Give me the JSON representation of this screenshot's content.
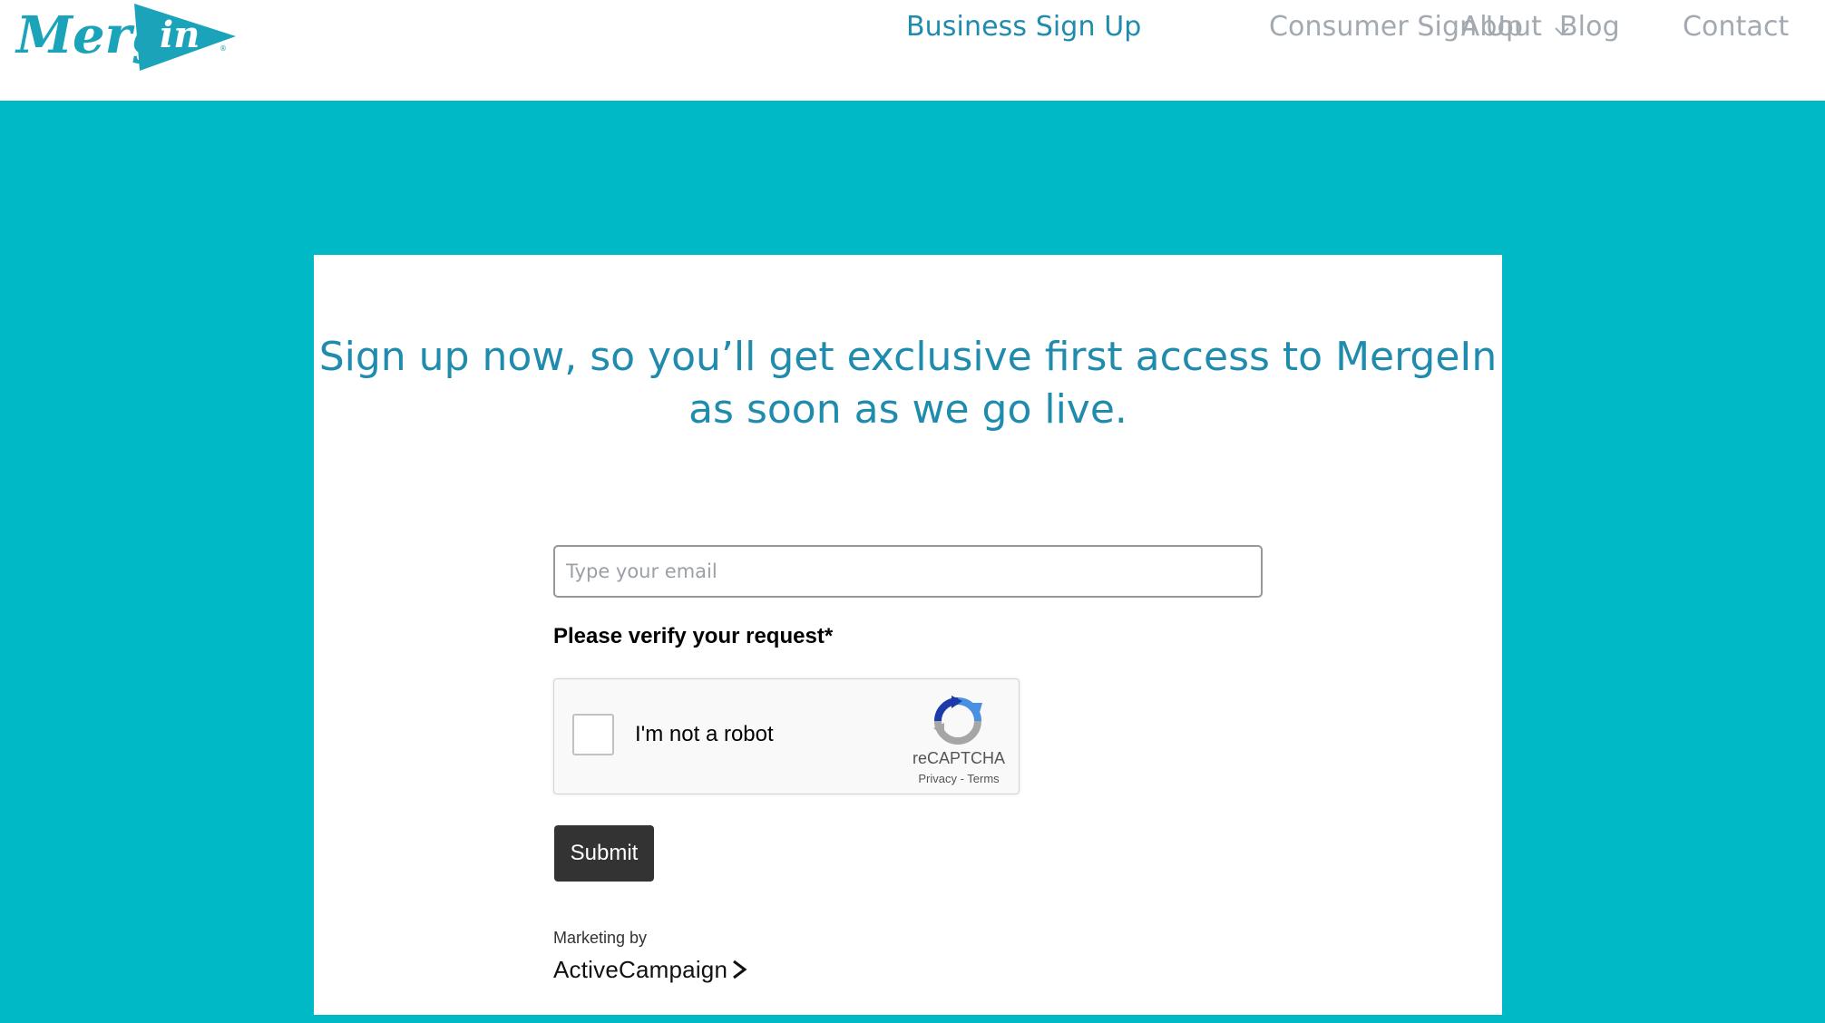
{
  "brand": {
    "logo_text": "Mergein",
    "colors": {
      "accent": "#1f8bad",
      "background": "#00b9c6",
      "nav_text": "#a2a9b1",
      "button": "#333333"
    }
  },
  "nav": {
    "items": [
      {
        "label": "About",
        "has_dropdown": true
      },
      {
        "label": "Business Sign Up",
        "active": true
      },
      {
        "label": "Consumer Sign Up"
      },
      {
        "label": "Blog"
      },
      {
        "label": "Contact"
      }
    ]
  },
  "main": {
    "headline_line1": "Sign up now, so you’ll get exclusive first access to MergeIn",
    "headline_line2": "as soon as we go live.",
    "email_placeholder": "Type your email",
    "email_value": "",
    "verify_label": "Please verify your request*",
    "submit_label": "Submit"
  },
  "recaptcha": {
    "label": "I'm not a robot",
    "brand": "reCAPTCHA",
    "privacy": "Privacy",
    "separator": " - ",
    "terms": "Terms",
    "checked": false
  },
  "footer": {
    "marketing_by": "Marketing by",
    "provider": "ActiveCampaign"
  }
}
